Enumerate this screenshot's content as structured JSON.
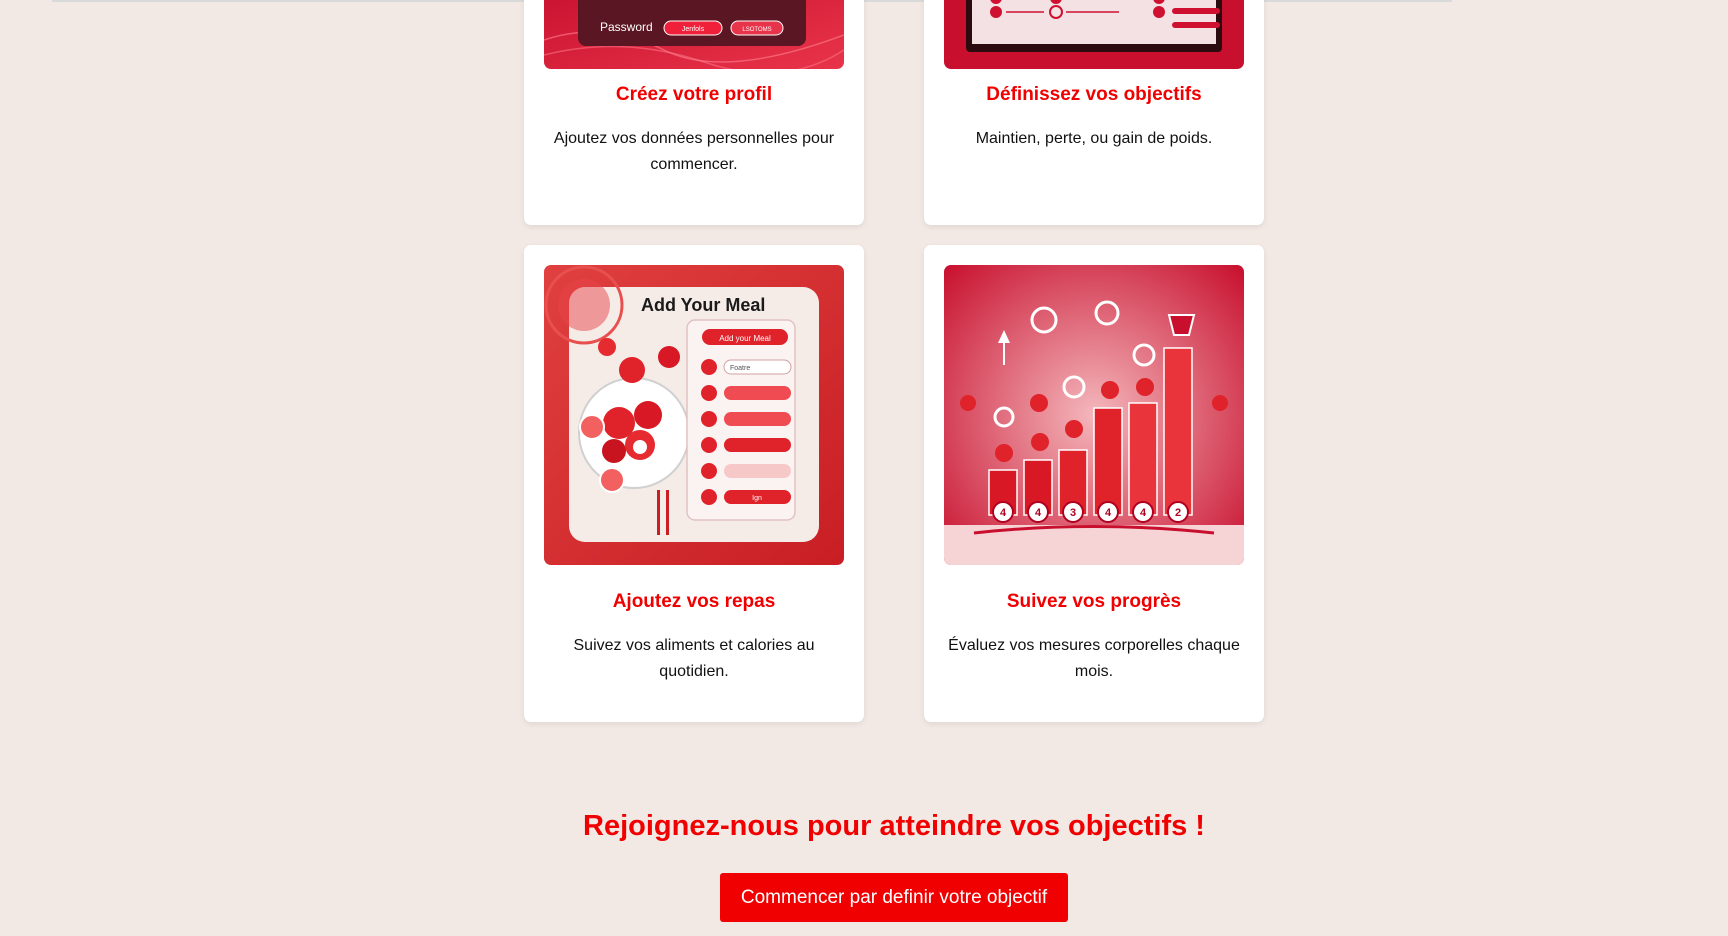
{
  "steps": [
    {
      "title": "Créez votre profil",
      "description": "Ajoutez vos données personnelles pour commencer.",
      "image": {
        "icon": "profile-login-illustration",
        "labels": [
          "Password",
          "Jenfols",
          "LSOTOMS"
        ]
      }
    },
    {
      "title": "Définissez vos objectifs",
      "description": "Maintien, perte, ou gain de poids.",
      "image": {
        "icon": "goals-checklist-illustration"
      }
    },
    {
      "title": "Ajoutez vos repas",
      "description": "Suivez vos aliments et calories au quotidien.",
      "image": {
        "icon": "add-meal-illustration",
        "labels": [
          "Add Your Meal",
          "Add your Meal",
          "Foatre",
          "Ign"
        ]
      }
    },
    {
      "title": "Suivez vos progrès",
      "description": "Évaluez vos mesures corporelles chaque mois.",
      "image": {
        "icon": "progress-chart-illustration",
        "labels": [
          "4",
          "4",
          "3",
          "4",
          "4",
          "2"
        ]
      }
    }
  ],
  "cta": {
    "title": "Rejoignez-nous pour atteindre vos objectifs !",
    "button_label": "Commencer par definir votre objectif"
  },
  "colors": {
    "accent": "#f00000",
    "background": "#f2e8e4",
    "card": "#ffffff"
  }
}
